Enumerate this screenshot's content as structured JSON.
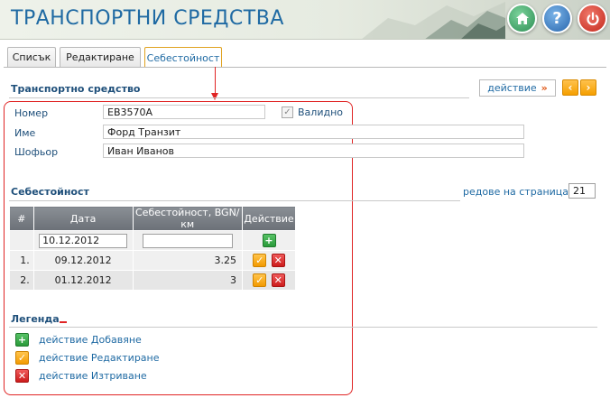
{
  "header": {
    "title": "ТРАНСПОРТНИ СРЕДСТВА",
    "buttons": {
      "home_icon": "home-icon",
      "help_label": "?",
      "power_icon": "power-icon"
    }
  },
  "tabs": [
    {
      "label": "Списък"
    },
    {
      "label": "Редактиране"
    },
    {
      "label": "Себестойност",
      "active": true
    }
  ],
  "vehicle_section": {
    "title": "Транспортно средство",
    "action_label": "действие",
    "action_chevron": "»",
    "prev_label": "‹",
    "next_label": "›",
    "fields": {
      "number_label": "Номер",
      "number_value": "ЕВ3570А",
      "valid_label": "Валидно",
      "valid_checked": true,
      "name_label": "Име",
      "name_value": "Форд Транзит",
      "driver_label": "Шофьор",
      "driver_value": "Иван Иванов"
    }
  },
  "cost_section": {
    "title": "Себестойност",
    "rows_per_page_label": "редове на страница",
    "rows_per_page_chevron": "»",
    "rows_per_page_value": "21",
    "table": {
      "headers": [
        "#",
        "Дата",
        "Себестойност, BGN/км",
        "Действие"
      ],
      "new_row": {
        "date_value": "10.12.2012",
        "cost_value": ""
      },
      "rows": [
        {
          "num": "1.",
          "date": "09.12.2012",
          "cost": "3.25"
        },
        {
          "num": "2.",
          "date": "01.12.2012",
          "cost": "3"
        }
      ]
    }
  },
  "legend": {
    "title": "Легенда",
    "items": [
      {
        "label": "действие Добавяне",
        "icon": "add-icon"
      },
      {
        "label": "действие Редактиране",
        "icon": "edit-icon"
      },
      {
        "label": "действие Изтриване",
        "icon": "delete-icon"
      }
    ]
  },
  "colors": {
    "title_blue": "#1f6aa3",
    "label_blue": "#1e4f7a",
    "highlight_red": "#e02424",
    "active_tab_border": "#e0a21f"
  }
}
